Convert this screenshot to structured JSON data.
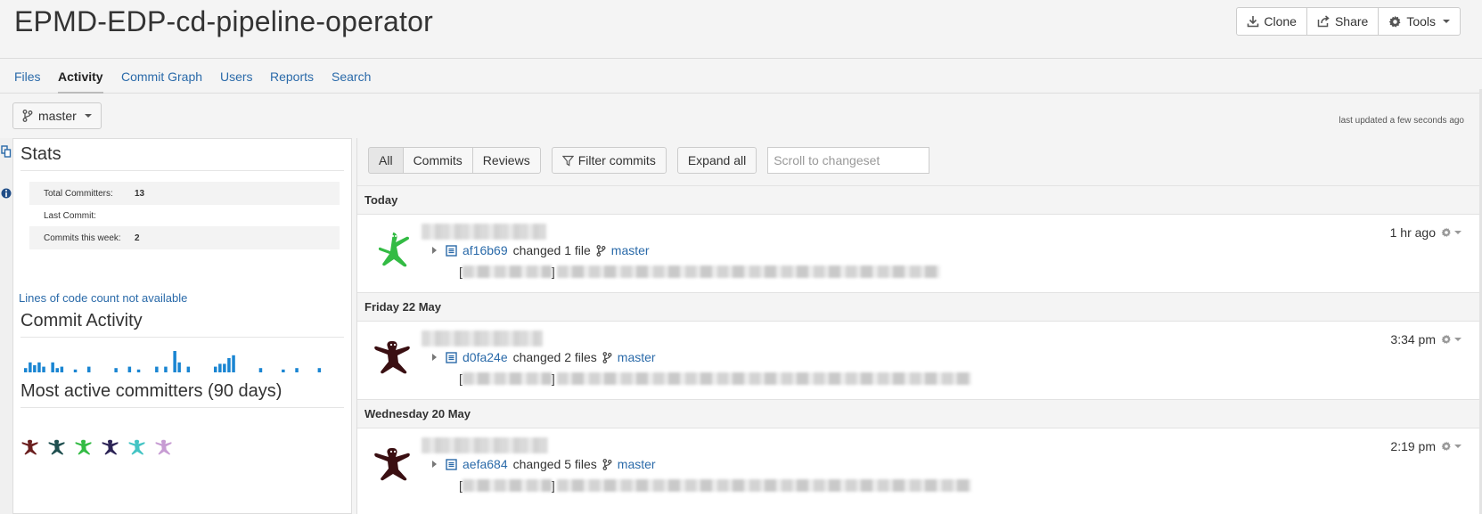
{
  "header": {
    "title": "EPMD-EDP-cd-pipeline-operator",
    "buttons": [
      {
        "label": "Clone",
        "icon": "download-icon"
      },
      {
        "label": "Share",
        "icon": "share-icon"
      },
      {
        "label": "Tools",
        "icon": "gear-icon"
      }
    ]
  },
  "nav": {
    "tabs": [
      {
        "label": "Files",
        "active": false
      },
      {
        "label": "Activity",
        "active": true
      },
      {
        "label": "Commit Graph",
        "active": false
      },
      {
        "label": "Users",
        "active": false
      },
      {
        "label": "Reports",
        "active": false
      },
      {
        "label": "Search",
        "active": false
      }
    ]
  },
  "branch": {
    "label": "master",
    "icon": "branch-icon"
  },
  "last_updated": "last updated a few seconds ago",
  "stats": {
    "title": "Stats",
    "rows": [
      {
        "key": "Total Committers:",
        "value": "13"
      },
      {
        "key": "Last Commit:",
        "value": ""
      },
      {
        "key": "Commits this week:",
        "value": "2"
      }
    ],
    "loc_link": "Lines of code count not available"
  },
  "commit_activity": {
    "title": "Commit Activity",
    "bars": [
      3,
      7,
      5,
      7,
      4,
      0,
      7,
      3,
      4,
      0,
      0,
      2,
      0,
      0,
      4,
      0,
      0,
      0,
      0,
      0,
      3,
      0,
      0,
      4,
      0,
      2,
      0,
      0,
      0,
      4,
      0,
      4,
      0,
      15,
      7,
      0,
      4,
      0,
      0,
      0,
      0,
      0,
      4,
      6,
      6,
      10,
      12,
      0,
      0,
      0,
      0,
      0,
      3,
      0,
      0,
      0,
      0,
      2,
      0,
      0,
      3,
      0,
      0,
      0,
      0,
      3,
      0,
      0,
      0,
      0
    ]
  },
  "committers": {
    "title": "Most active committers (90 days)",
    "avatar_colors": [
      "#6b1f1f",
      "#1f4f4f",
      "#33bb44",
      "#2d2456",
      "#44c4c4",
      "#c79cd3"
    ]
  },
  "filters": {
    "segment": [
      {
        "label": "All",
        "selected": true
      },
      {
        "label": "Commits",
        "selected": false
      },
      {
        "label": "Reviews",
        "selected": false
      }
    ],
    "filter_label": "Filter commits",
    "expand_label": "Expand all",
    "scroll_placeholder": "Scroll to changeset"
  },
  "days": [
    {
      "label": "Today",
      "commits": [
        {
          "hash": "af16b69",
          "changed": "changed 1 file",
          "branch": "master",
          "time": "1 hr ago",
          "avatar_color": "#33bb44"
        }
      ]
    },
    {
      "label": "Friday 22 May",
      "commits": [
        {
          "hash": "d0fa24e",
          "changed": "changed 2 files",
          "branch": "master",
          "time": "3:34 pm",
          "avatar_color": "#3a0f12"
        }
      ]
    },
    {
      "label": "Wednesday 20 May",
      "commits": [
        {
          "hash": "aefa684",
          "changed": "changed 5 files",
          "branch": "master",
          "time": "2:19 pm",
          "avatar_color": "#3a0f12"
        }
      ]
    }
  ]
}
